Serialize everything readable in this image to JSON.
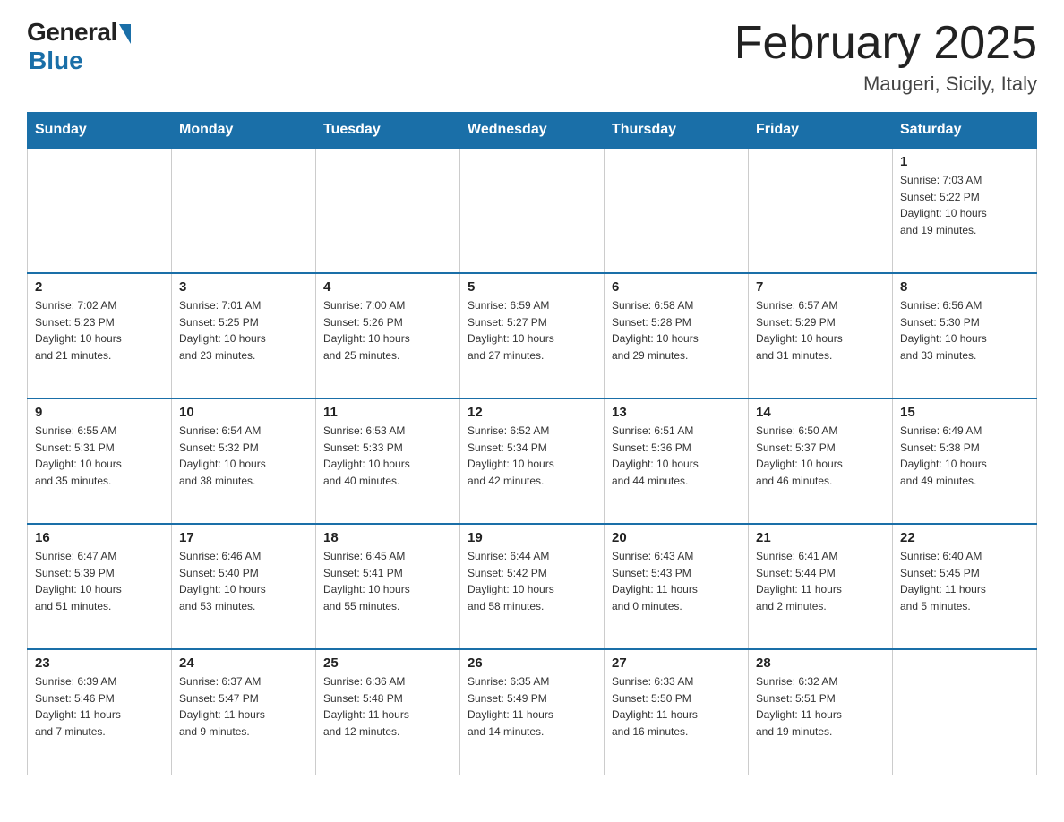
{
  "logo": {
    "general": "General",
    "blue": "Blue",
    "subtitle": "Blue"
  },
  "header": {
    "month": "February 2025",
    "location": "Maugeri, Sicily, Italy"
  },
  "weekdays": [
    "Sunday",
    "Monday",
    "Tuesday",
    "Wednesday",
    "Thursday",
    "Friday",
    "Saturday"
  ],
  "weeks": [
    [
      {
        "day": "",
        "info": ""
      },
      {
        "day": "",
        "info": ""
      },
      {
        "day": "",
        "info": ""
      },
      {
        "day": "",
        "info": ""
      },
      {
        "day": "",
        "info": ""
      },
      {
        "day": "",
        "info": ""
      },
      {
        "day": "1",
        "info": "Sunrise: 7:03 AM\nSunset: 5:22 PM\nDaylight: 10 hours\nand 19 minutes."
      }
    ],
    [
      {
        "day": "2",
        "info": "Sunrise: 7:02 AM\nSunset: 5:23 PM\nDaylight: 10 hours\nand 21 minutes."
      },
      {
        "day": "3",
        "info": "Sunrise: 7:01 AM\nSunset: 5:25 PM\nDaylight: 10 hours\nand 23 minutes."
      },
      {
        "day": "4",
        "info": "Sunrise: 7:00 AM\nSunset: 5:26 PM\nDaylight: 10 hours\nand 25 minutes."
      },
      {
        "day": "5",
        "info": "Sunrise: 6:59 AM\nSunset: 5:27 PM\nDaylight: 10 hours\nand 27 minutes."
      },
      {
        "day": "6",
        "info": "Sunrise: 6:58 AM\nSunset: 5:28 PM\nDaylight: 10 hours\nand 29 minutes."
      },
      {
        "day": "7",
        "info": "Sunrise: 6:57 AM\nSunset: 5:29 PM\nDaylight: 10 hours\nand 31 minutes."
      },
      {
        "day": "8",
        "info": "Sunrise: 6:56 AM\nSunset: 5:30 PM\nDaylight: 10 hours\nand 33 minutes."
      }
    ],
    [
      {
        "day": "9",
        "info": "Sunrise: 6:55 AM\nSunset: 5:31 PM\nDaylight: 10 hours\nand 35 minutes."
      },
      {
        "day": "10",
        "info": "Sunrise: 6:54 AM\nSunset: 5:32 PM\nDaylight: 10 hours\nand 38 minutes."
      },
      {
        "day": "11",
        "info": "Sunrise: 6:53 AM\nSunset: 5:33 PM\nDaylight: 10 hours\nand 40 minutes."
      },
      {
        "day": "12",
        "info": "Sunrise: 6:52 AM\nSunset: 5:34 PM\nDaylight: 10 hours\nand 42 minutes."
      },
      {
        "day": "13",
        "info": "Sunrise: 6:51 AM\nSunset: 5:36 PM\nDaylight: 10 hours\nand 44 minutes."
      },
      {
        "day": "14",
        "info": "Sunrise: 6:50 AM\nSunset: 5:37 PM\nDaylight: 10 hours\nand 46 minutes."
      },
      {
        "day": "15",
        "info": "Sunrise: 6:49 AM\nSunset: 5:38 PM\nDaylight: 10 hours\nand 49 minutes."
      }
    ],
    [
      {
        "day": "16",
        "info": "Sunrise: 6:47 AM\nSunset: 5:39 PM\nDaylight: 10 hours\nand 51 minutes."
      },
      {
        "day": "17",
        "info": "Sunrise: 6:46 AM\nSunset: 5:40 PM\nDaylight: 10 hours\nand 53 minutes."
      },
      {
        "day": "18",
        "info": "Sunrise: 6:45 AM\nSunset: 5:41 PM\nDaylight: 10 hours\nand 55 minutes."
      },
      {
        "day": "19",
        "info": "Sunrise: 6:44 AM\nSunset: 5:42 PM\nDaylight: 10 hours\nand 58 minutes."
      },
      {
        "day": "20",
        "info": "Sunrise: 6:43 AM\nSunset: 5:43 PM\nDaylight: 11 hours\nand 0 minutes."
      },
      {
        "day": "21",
        "info": "Sunrise: 6:41 AM\nSunset: 5:44 PM\nDaylight: 11 hours\nand 2 minutes."
      },
      {
        "day": "22",
        "info": "Sunrise: 6:40 AM\nSunset: 5:45 PM\nDaylight: 11 hours\nand 5 minutes."
      }
    ],
    [
      {
        "day": "23",
        "info": "Sunrise: 6:39 AM\nSunset: 5:46 PM\nDaylight: 11 hours\nand 7 minutes."
      },
      {
        "day": "24",
        "info": "Sunrise: 6:37 AM\nSunset: 5:47 PM\nDaylight: 11 hours\nand 9 minutes."
      },
      {
        "day": "25",
        "info": "Sunrise: 6:36 AM\nSunset: 5:48 PM\nDaylight: 11 hours\nand 12 minutes."
      },
      {
        "day": "26",
        "info": "Sunrise: 6:35 AM\nSunset: 5:49 PM\nDaylight: 11 hours\nand 14 minutes."
      },
      {
        "day": "27",
        "info": "Sunrise: 6:33 AM\nSunset: 5:50 PM\nDaylight: 11 hours\nand 16 minutes."
      },
      {
        "day": "28",
        "info": "Sunrise: 6:32 AM\nSunset: 5:51 PM\nDaylight: 11 hours\nand 19 minutes."
      },
      {
        "day": "",
        "info": ""
      }
    ]
  ]
}
